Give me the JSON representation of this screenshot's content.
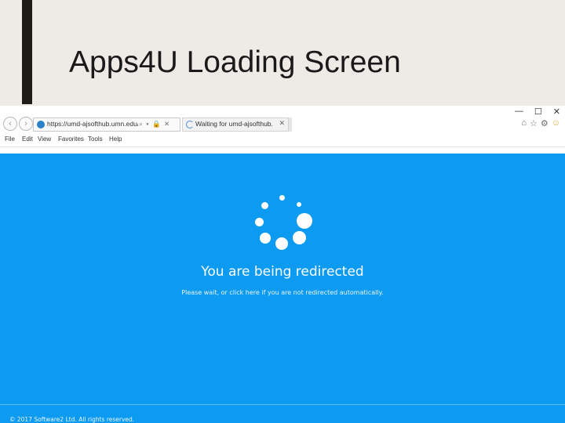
{
  "slide": {
    "title": "Apps4U Loading Screen"
  },
  "browser": {
    "address_url": "https://umd-ajsofthub.umn.edu/sso",
    "address_icons": "⌕ ▾ 🔒 ✕",
    "tab_title": "Waiting for umd-ajsofthub....",
    "tab_close": "✕",
    "window_controls": [
      "—",
      "☐",
      "✕"
    ],
    "toolbar_icons": [
      "⌂",
      "☆",
      "⚙",
      "☺"
    ],
    "menu": [
      "File",
      "Edit",
      "View",
      "Favorites",
      "Tools",
      "Help"
    ]
  },
  "page": {
    "background_color": "#0d9bf1",
    "heading": "You are being redirected",
    "subtext": "Please wait, or click here if you are not redirected automatically.",
    "copyright": "© 2017 Software2 Ltd. All rights reserved."
  }
}
